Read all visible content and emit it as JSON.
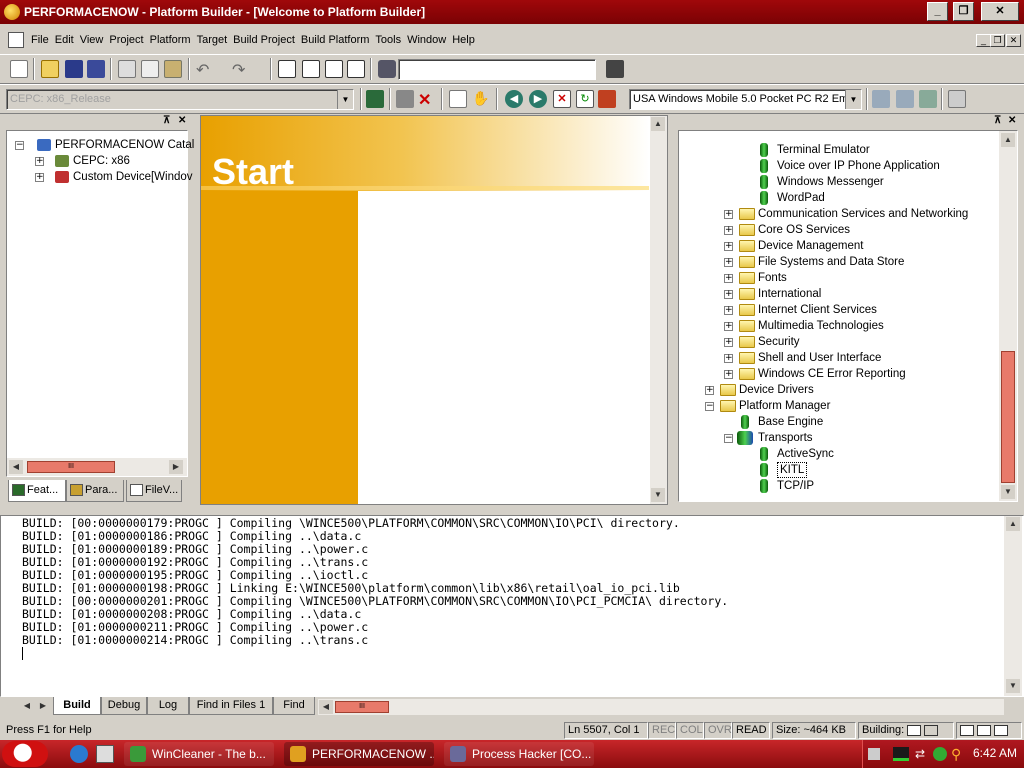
{
  "window": {
    "title": "PERFORMACENOW - Platform Builder - [Welcome to Platform Builder]"
  },
  "menu": [
    "File",
    "Edit",
    "View",
    "Project",
    "Platform",
    "Target",
    "Build Project",
    "Build Platform",
    "Tools",
    "Window",
    "Help"
  ],
  "toolbar": {
    "find_combo_value": "",
    "config_combo_value": "CEPC: x86_Release",
    "sdk_combo_value": "USA Windows Mobile 5.0 Pocket PC R2 Em"
  },
  "workspace": {
    "tree": [
      {
        "label": "PERFORMACENOW Catal",
        "expander": "−"
      },
      {
        "label": "CEPC: x86",
        "expander": "+"
      },
      {
        "label": "Custom Device[Windov",
        "expander": "+"
      }
    ],
    "tabs": [
      "Feat...",
      "Para...",
      "FileV..."
    ]
  },
  "start_page": {
    "heading": "Start"
  },
  "catalog": {
    "items": [
      {
        "label": "Terminal Emulator",
        "kind": "component"
      },
      {
        "label": "Voice over IP Phone Application",
        "kind": "component"
      },
      {
        "label": "Windows Messenger",
        "kind": "component"
      },
      {
        "label": "WordPad",
        "kind": "component"
      },
      {
        "label": "Communication Services and Networking",
        "kind": "folder"
      },
      {
        "label": "Core OS Services",
        "kind": "folder"
      },
      {
        "label": "Device Management",
        "kind": "folder"
      },
      {
        "label": "File Systems and Data Store",
        "kind": "folder"
      },
      {
        "label": "Fonts",
        "kind": "folder"
      },
      {
        "label": "International",
        "kind": "folder"
      },
      {
        "label": "Internet Client Services",
        "kind": "folder"
      },
      {
        "label": "Multimedia Technologies",
        "kind": "folder"
      },
      {
        "label": "Security",
        "kind": "folder"
      },
      {
        "label": "Shell and User Interface",
        "kind": "folder"
      },
      {
        "label": "Windows CE Error Reporting",
        "kind": "folder"
      },
      {
        "label": "Device Drivers",
        "kind": "folder"
      },
      {
        "label": "Platform Manager",
        "kind": "open-folder"
      },
      {
        "label": "Base Engine",
        "kind": "component"
      },
      {
        "label": "Transports",
        "kind": "component-group"
      },
      {
        "label": "ActiveSync",
        "kind": "component"
      },
      {
        "label": "KITL",
        "kind": "component",
        "selected": true
      },
      {
        "label": "TCP/IP",
        "kind": "component"
      }
    ]
  },
  "output": {
    "lines": [
      "BUILD: [00:0000000179:PROGC ] Compiling \\WINCE500\\PLATFORM\\COMMON\\SRC\\COMMON\\IO\\PCI\\ directory.",
      "BUILD: [01:0000000186:PROGC ] Compiling ..\\data.c",
      "BUILD: [01:0000000189:PROGC ] Compiling ..\\power.c",
      "BUILD: [01:0000000192:PROGC ] Compiling ..\\trans.c",
      "BUILD: [01:0000000195:PROGC ] Compiling ..\\ioctl.c",
      "BUILD: [01:0000000198:PROGC ] Linking E:\\WINCE500\\platform\\common\\lib\\x86\\retail\\oal_io_pci.lib",
      "BUILD: [00:0000000201:PROGC ] Compiling \\WINCE500\\PLATFORM\\COMMON\\SRC\\COMMON\\IO\\PCI_PCMCIA\\ directory.",
      "BUILD: [01:0000000208:PROGC ] Compiling ..\\data.c",
      "BUILD: [01:0000000211:PROGC ] Compiling ..\\power.c",
      "BUILD: [01:0000000214:PROGC ] Compiling ..\\trans.c"
    ],
    "tabs": [
      "Build",
      "Debug",
      "Log",
      "Find in Files 1",
      "Find"
    ]
  },
  "status": {
    "help": "Press F1 for Help",
    "position": "Ln 5507, Col 1",
    "rec": "REC",
    "col": "COL",
    "ovr": "OVR",
    "read": "READ",
    "size": "Size: ~464 KB",
    "building": "Building:"
  },
  "taskbar": {
    "buttons": [
      {
        "label": "WinCleaner - The b...",
        "color": "#3a9a3a"
      },
      {
        "label": "PERFORMACENOW ...",
        "color": "#e0a020"
      },
      {
        "label": "Process Hacker [CO...",
        "color": "#6a6a9a"
      }
    ],
    "clock": "6:42 AM"
  },
  "colors": {
    "titlebar": "#8a0204",
    "accent_orange": "#e8a000",
    "taskbar": "#b01a1c"
  }
}
